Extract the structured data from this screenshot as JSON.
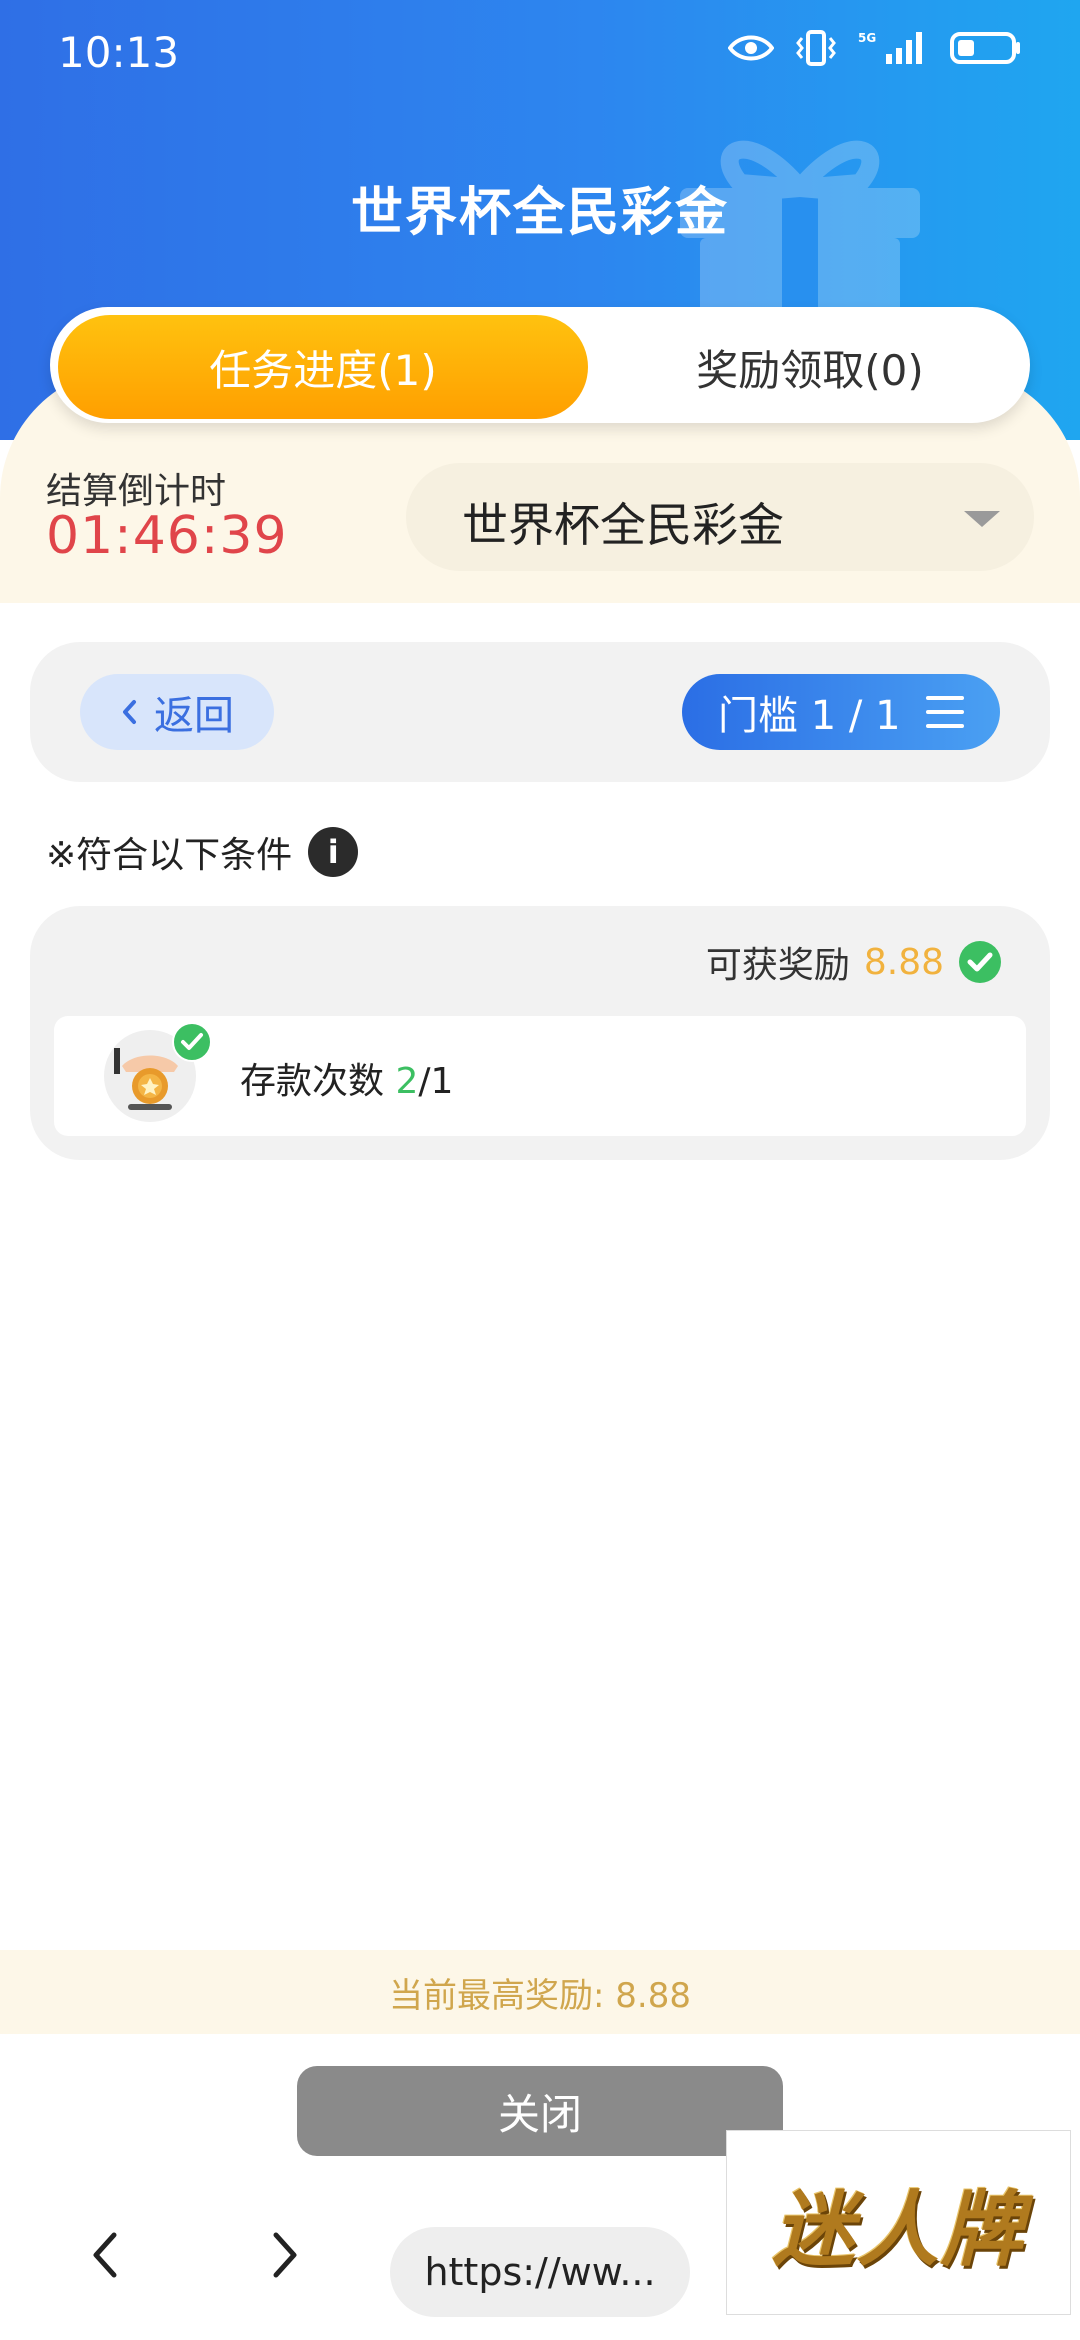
{
  "status_bar": {
    "time": "10:13",
    "network": "5G"
  },
  "header": {
    "title": "世界杯全民彩金"
  },
  "tabs": [
    {
      "label": "任务进度(1)",
      "active": true
    },
    {
      "label": "奖励领取(0)",
      "active": false
    }
  ],
  "countdown": {
    "label": "结算倒计时",
    "value": "01:46:39"
  },
  "event_select": {
    "selected": "世界杯全民彩金"
  },
  "nav": {
    "back_label": "返回",
    "threshold_label": "门槛 1 / 1"
  },
  "conditions": {
    "label": "※符合以下条件",
    "info_glyph": "i"
  },
  "reward": {
    "label": "可获奖励",
    "value": "8.88",
    "task": {
      "name": "存款次数",
      "progress_done": "2",
      "progress_total": "/1"
    }
  },
  "footer": {
    "max_reward_text": "当前最高奖励: 8.88",
    "close_label": "关闭",
    "url": "https://ww..."
  },
  "brand": {
    "text": "迷人牌"
  },
  "colors": {
    "header_blue": "#2f6fe6",
    "accent_orange": "#ff9f00",
    "countdown_red": "#e0454a",
    "reward_gold": "#f1b23e",
    "success_green": "#3cbf62"
  }
}
